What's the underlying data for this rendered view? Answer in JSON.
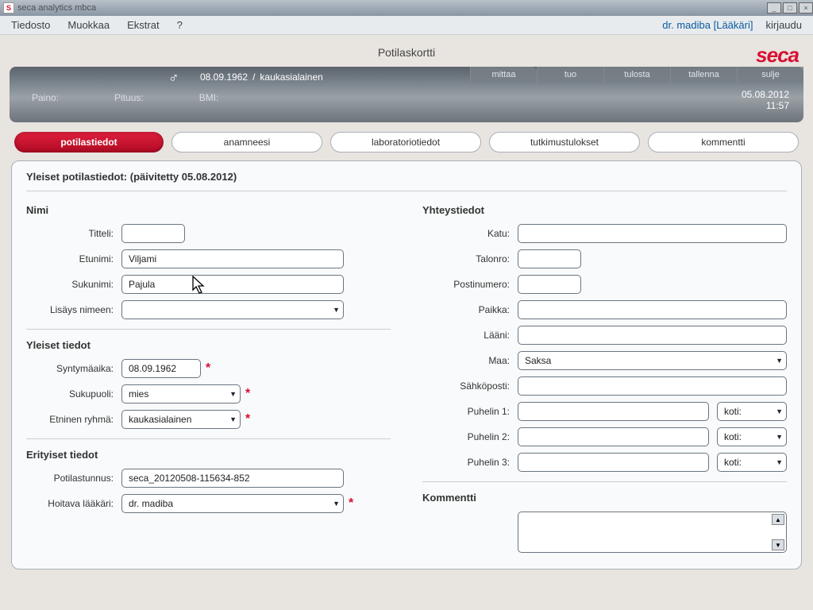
{
  "window": {
    "title": "seca analytics mbca"
  },
  "menu": {
    "file": "Tiedosto",
    "edit": "Muokkaa",
    "extras": "Ekstrat",
    "help": "?",
    "user": "dr. madiba [Lääkäri]",
    "logout": "kirjaudu"
  },
  "header": {
    "title": "Potilaskortti",
    "logo": "seca",
    "dob": "08.09.1962",
    "sep": "/",
    "ethnicity": "kaukasialainen",
    "weight_lbl": "Paino:",
    "height_lbl": "Pituus:",
    "bmi_lbl": "BMI:",
    "date": "05.08.2012",
    "time": "11:57",
    "actions": {
      "measure": "mittaa",
      "import": "tuo",
      "print": "tulosta",
      "save": "tallenna",
      "close": "sulje"
    }
  },
  "tabs": {
    "patient": "potilastiedot",
    "history": "anamneesi",
    "lab": "laboratoriotiedot",
    "results": "tutkimustulokset",
    "comment": "kommentti"
  },
  "panel": {
    "head": "Yleiset potilastiedot: (päivitetty  05.08.2012)",
    "name_h": "Nimi",
    "title_lbl": "Titteli:",
    "first_lbl": "Etunimi:",
    "first_val": "Viljami",
    "last_lbl": "Sukunimi:",
    "last_val": "Pajula",
    "suffix_lbl": "Lisäys nimeen:",
    "general_h": "Yleiset tiedot",
    "dob_lbl": "Syntymäaika:",
    "dob_val": "08.09.1962",
    "gender_lbl": "Sukupuoli:",
    "gender_val": "mies",
    "ethnic_lbl": "Etninen ryhmä:",
    "ethnic_val": "kaukasialainen",
    "special_h": "Erityiset tiedot",
    "pid_lbl": "Potilastunnus:",
    "pid_val": "seca_20120508-115634-852",
    "doctor_lbl": "Hoitava lääkäri:",
    "doctor_val": "dr. madiba",
    "contact_h": "Yhteystiedot",
    "street_lbl": "Katu:",
    "houseno_lbl": "Talonro:",
    "zip_lbl": "Postinumero:",
    "city_lbl": "Paikka:",
    "state_lbl": "Lääni:",
    "country_lbl": "Maa:",
    "country_val": "Saksa",
    "email_lbl": "Sähköposti:",
    "phone1_lbl": "Puhelin 1:",
    "phone2_lbl": "Puhelin 2:",
    "phone3_lbl": "Puhelin 3:",
    "phone_type": "koti:",
    "comment_h": "Kommentti"
  }
}
